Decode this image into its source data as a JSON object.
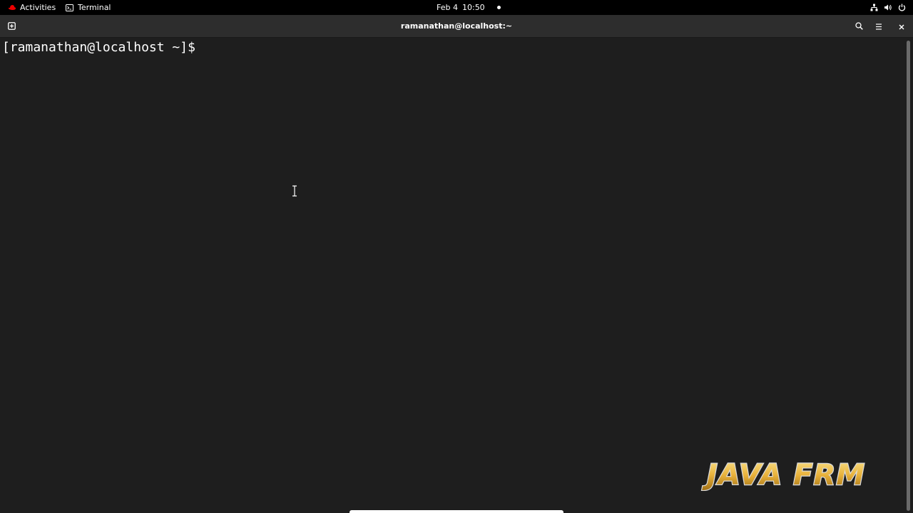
{
  "topbar": {
    "activities_label": "Activities",
    "activities_icon": "redhat-logo-icon",
    "app_icon": "terminal-icon",
    "app_label": "Terminal",
    "date": "Feb 4",
    "time": "10:50",
    "tray_icons": [
      "network-icon",
      "volume-icon",
      "power-icon"
    ]
  },
  "window": {
    "title": "ramanathan@localhost:~",
    "buttons": [
      "new-tab-icon",
      "search-icon",
      "hamburger-menu-icon",
      "close-icon"
    ]
  },
  "terminal": {
    "prompt": "[ramanathan@localhost ~]$ "
  },
  "watermark": {
    "text": "JAVA FRM"
  },
  "colors": {
    "topbar_bg": "#000000",
    "headerbar_bg": "#2d2d2d",
    "terminal_bg": "#1e1e1e",
    "terminal_fg": "#ffffff",
    "redhat_red": "#ee0000",
    "watermark_gold": "#e8b13a"
  }
}
